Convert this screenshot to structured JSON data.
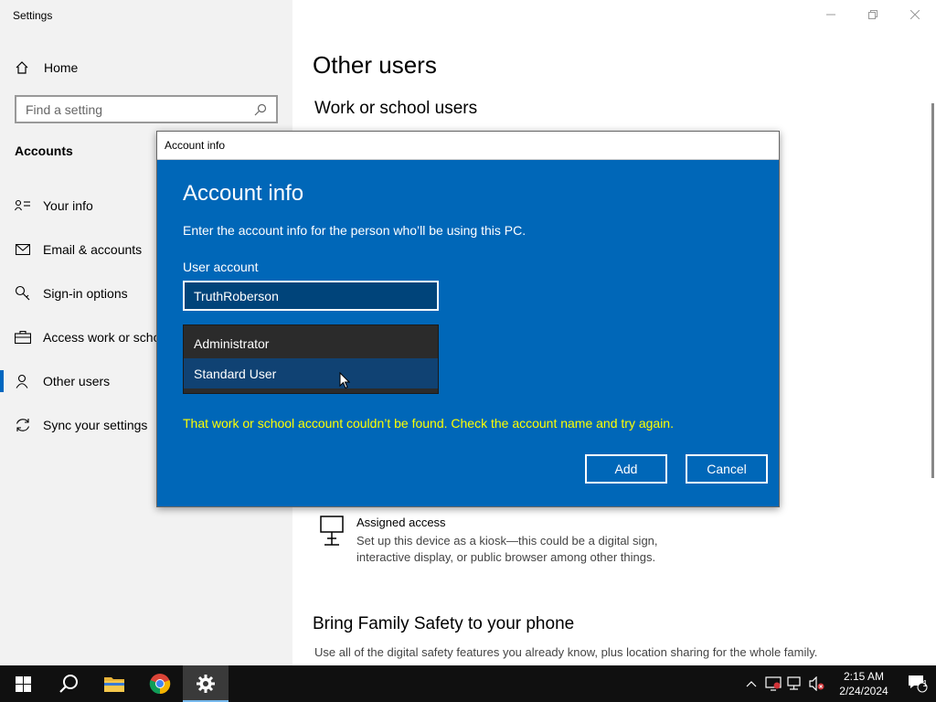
{
  "app": {
    "title": "Settings"
  },
  "sidebar": {
    "home_label": "Home",
    "search_placeholder": "Find a setting",
    "section_label": "Accounts",
    "items": [
      {
        "label": "Your info",
        "icon": "person-card-icon"
      },
      {
        "label": "Email & accounts",
        "icon": "mail-icon"
      },
      {
        "label": "Sign-in options",
        "icon": "key-icon"
      },
      {
        "label": "Access work or scho",
        "icon": "briefcase-icon"
      },
      {
        "label": "Other users",
        "icon": "person-icon",
        "active": true
      },
      {
        "label": "Sync your settings",
        "icon": "sync-icon"
      }
    ]
  },
  "main": {
    "title": "Other users",
    "subtitle": "Work or school users",
    "assigned_access": {
      "title": "Assigned access",
      "desc_line1": "Set up this device as a kiosk—this could be a digital sign,",
      "desc_line2": "interactive display, or public browser among other things."
    },
    "family": {
      "title": "Bring Family Safety to your phone",
      "desc": "Use all of the digital safety features you already know, plus location sharing for the whole family."
    }
  },
  "dialog": {
    "titlebar": "Account info",
    "heading": "Account info",
    "description": "Enter the account info for the person who’ll be using this PC.",
    "user_label": "User account",
    "user_value": "TruthRoberson",
    "dropdown_options": [
      "Administrator",
      "Standard User"
    ],
    "error": "That work or school account couldn’t be found. Check the account name and try again.",
    "add_label": "Add",
    "cancel_label": "Cancel"
  },
  "taskbar": {
    "time": "2:15 AM",
    "date": "2/24/2024",
    "notification_count": "1"
  },
  "colors": {
    "dialog_bg": "#0067b8",
    "error_text": "#ffff00",
    "accent": "#0067c0"
  }
}
